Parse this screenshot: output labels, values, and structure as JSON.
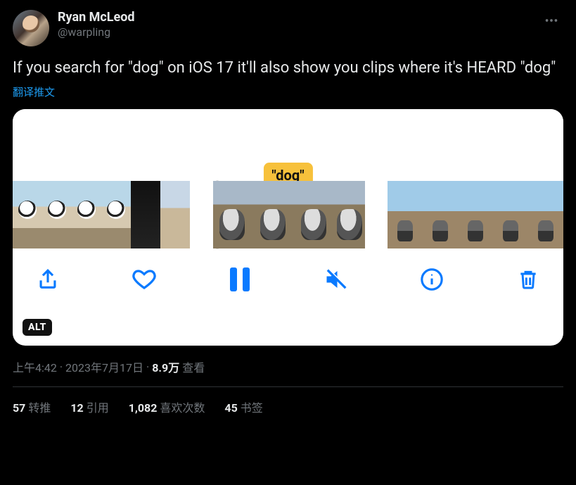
{
  "author": {
    "display_name": "Ryan McLeod",
    "handle": "@warpling"
  },
  "tweet_text": "If you search for \"dog\" on iOS 17 it'll also show you clips where it's HEARD \"dog\"",
  "translate_label": "翻译推文",
  "media": {
    "search_term_label": "\"dog\"",
    "alt_badge": "ALT",
    "toolbar": {
      "share": "share",
      "like": "like",
      "pause": "pause",
      "mute": "mute",
      "info": "info",
      "trash": "trash"
    }
  },
  "timestamp": {
    "time": "上午4:42",
    "sep1": " · ",
    "date": "2023年7月17日",
    "sep2": " · ",
    "views_count": "8.9万",
    "views_label": " 查看"
  },
  "engagement": {
    "retweets": {
      "count": "57",
      "label": "转推"
    },
    "quotes": {
      "count": "12",
      "label": "引用"
    },
    "likes": {
      "count": "1,082",
      "label": "喜欢次数"
    },
    "bookmarks": {
      "count": "45",
      "label": "书签"
    }
  }
}
